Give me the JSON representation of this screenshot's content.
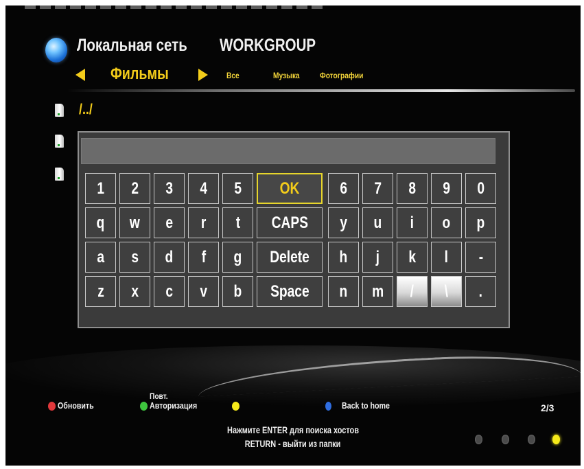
{
  "header": {
    "title": "Локальная сеть",
    "workgroup": "WORKGROUP",
    "current_category": "Фильмы",
    "other_categories": [
      "Все",
      "Музыка",
      "Фотографии"
    ]
  },
  "file_list": {
    "items": [
      "/../"
    ]
  },
  "keyboard": {
    "input_value": "",
    "rows": [
      [
        "1",
        "2",
        "3",
        "4",
        "5",
        "OK",
        "6",
        "7",
        "8",
        "9",
        "0"
      ],
      [
        "q",
        "w",
        "e",
        "r",
        "t",
        "CAPS",
        "y",
        "u",
        "i",
        "o",
        "p"
      ],
      [
        "a",
        "s",
        "d",
        "f",
        "g",
        "Delete",
        "h",
        "j",
        "k",
        "l",
        "-"
      ],
      [
        "z",
        "x",
        "c",
        "v",
        "b",
        "Space",
        "n",
        "m",
        "/",
        "\\",
        "."
      ]
    ],
    "selected_key": "OK"
  },
  "footer": {
    "refresh": "Обновить",
    "reauth_line1": "Повт.",
    "reauth_line2": "Авторизация",
    "yellow_label": "",
    "back_home": "Back to home",
    "page_counter": "2/3",
    "hint_line1": "Нажмите ENTER для поиска хостов",
    "hint_line2": "RETURN - выйти из папки",
    "page_dots_total": 4,
    "page_dot_active": 4
  },
  "colors": {
    "accent_yellow": "#f3cc1a",
    "red": "#e0383b",
    "green": "#3ec43e",
    "yellow": "#f6ea1a",
    "blue": "#2f6de0"
  }
}
